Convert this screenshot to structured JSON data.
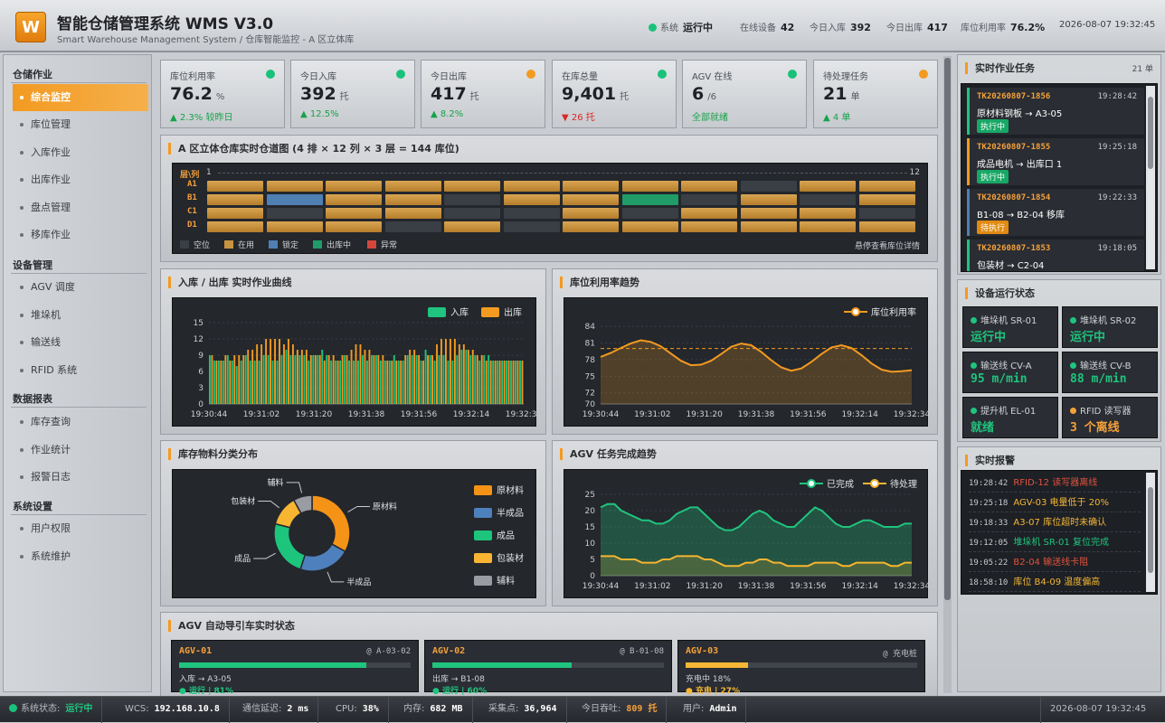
{
  "header": {
    "logo": "W",
    "title": "智能仓储管理系统 WMS V3.0",
    "subtitle": "Smart Warehouse Management System / 仓库智能监控 - A 区立体库",
    "stats": [
      {
        "label": "系统",
        "value": "运行中"
      },
      {
        "label": "在线设备",
        "value": "42"
      },
      {
        "label": "今日入库",
        "value": "392"
      },
      {
        "label": "今日出库",
        "value": "417"
      },
      {
        "label": "库位利用率",
        "value": "76.2%"
      }
    ],
    "datetime": "2026-08-07 19:32:45"
  },
  "sidebar": {
    "groups": [
      {
        "title": "仓储作业",
        "items": [
          "综合监控",
          "库位管理",
          "入库作业",
          "出库作业",
          "盘点管理",
          "移库作业"
        ]
      },
      {
        "title": "设备管理",
        "items": [
          "AGV 调度",
          "堆垛机",
          "输送线",
          "RFID 系统"
        ]
      },
      {
        "title": "数据报表",
        "items": [
          "库存查询",
          "作业统计",
          "报警日志"
        ]
      },
      {
        "title": "系统设置",
        "items": [
          "用户权限",
          "系统维护"
        ]
      }
    ],
    "active": "综合监控"
  },
  "kpis": [
    {
      "label": "库位利用率",
      "value": "76.2",
      "unit": "%",
      "delta": "▲ 2.3% 较昨日",
      "dot": "#19c27a",
      "delta_color": "#16a34a"
    },
    {
      "label": "今日入库",
      "value": "392",
      "unit": "托",
      "delta": "▲ 12.5%",
      "dot": "#19c27a",
      "delta_color": "#16a34a"
    },
    {
      "label": "今日出库",
      "value": "417",
      "unit": "托",
      "delta": "▲ 8.2%",
      "dot": "#f39a21",
      "delta_color": "#16a34a"
    },
    {
      "label": "在库总量",
      "value": "9,401",
      "unit": "托",
      "delta": "▼ 26 托",
      "dot": "#19c27a",
      "delta_color": "#dc2626"
    },
    {
      "label": "AGV 在线",
      "value": "6",
      "unit": "/6",
      "delta": "全部就绪",
      "dot": "#19c27a",
      "delta_color": "#16a34a"
    },
    {
      "label": "待处理任务",
      "value": "21",
      "unit": "单",
      "delta": "▲ 4 单",
      "dot": "#f39a21",
      "delta_color": "#16a34a"
    }
  ],
  "warehouse": {
    "title": "A 区立体仓库实时仓道图 (4 排 × 12 列 × 3 层 = 144 库位)",
    "corner": "层\\列",
    "col_first": "1",
    "col_last": "12",
    "rows": [
      "A1",
      "B1",
      "C1",
      "D1"
    ],
    "cells": [
      [
        "occupied",
        "occupied",
        "occupied",
        "occupied",
        "occupied",
        "occupied",
        "occupied",
        "occupied",
        "occupied",
        "empty",
        "occupied",
        "occupied"
      ],
      [
        "occupied",
        "locked",
        "occupied",
        "occupied",
        "empty",
        "occupied",
        "occupied",
        "outbound",
        "empty",
        "occupied",
        "empty",
        "occupied"
      ],
      [
        "occupied",
        "empty",
        "occupied",
        "occupied",
        "empty",
        "empty",
        "occupied",
        "empty",
        "occupied",
        "occupied",
        "occupied",
        "empty"
      ],
      [
        "occupied",
        "occupied",
        "occupied",
        "empty",
        "occupied",
        "empty",
        "occupied",
        "occupied",
        "occupied",
        "occupied",
        "occupied",
        "occupied"
      ]
    ],
    "legend": [
      {
        "key": "empty",
        "label": "空位",
        "color": "#3a3e45"
      },
      {
        "key": "occupied",
        "label": "在用",
        "color": "#c9943f"
      },
      {
        "key": "locked",
        "label": "锁定",
        "color": "#4f7fb3"
      },
      {
        "key": "outbound",
        "label": "出库中",
        "color": "#1f9c67"
      },
      {
        "key": "error",
        "label": "异常",
        "color": "#d2463c"
      }
    ],
    "hint": "悬停查看库位详情"
  },
  "chart_data": [
    {
      "type": "bar",
      "title": "入库 / 出库 实时作业曲线",
      "x_ticks": [
        "19:30:44",
        "19:31:02",
        "19:31:20",
        "19:31:38",
        "19:31:56",
        "19:32:14",
        "19:32:34"
      ],
      "ylim": [
        0,
        15
      ],
      "y_ticks": [
        0,
        3,
        6,
        9,
        12,
        15
      ],
      "series": [
        {
          "name": "入库",
          "color": "#1fc47e",
          "values": [
            9,
            8,
            8,
            8,
            9,
            8,
            7,
            8,
            9,
            8,
            8,
            8,
            9,
            9,
            8,
            8,
            9,
            10,
            9,
            9,
            9,
            9,
            8,
            9,
            9,
            10,
            9,
            8,
            8,
            8,
            9,
            8,
            8,
            8,
            9,
            8,
            9,
            9,
            8,
            8,
            8,
            9,
            8,
            8,
            9,
            9,
            9,
            8,
            10,
            9,
            8,
            9,
            9,
            8,
            8,
            9,
            10,
            10,
            9,
            9,
            8,
            9,
            9,
            8,
            8,
            8,
            8,
            8,
            8,
            8
          ]
        },
        {
          "name": "出库",
          "color": "#f39a21",
          "values": [
            9,
            8,
            8,
            9,
            8,
            9,
            9,
            9,
            10,
            10,
            11,
            11,
            12,
            12,
            12,
            12,
            11,
            12,
            11,
            10,
            10,
            10,
            9,
            9,
            9,
            8,
            9,
            9,
            8,
            9,
            9,
            10,
            11,
            11,
            10,
            10,
            9,
            9,
            9,
            8,
            8,
            8,
            8,
            9,
            10,
            10,
            9,
            8,
            9,
            9,
            11,
            12,
            12,
            12,
            12,
            11,
            11,
            10,
            10,
            9,
            9,
            8,
            8,
            8,
            8,
            8,
            8,
            8,
            8,
            8
          ]
        }
      ]
    },
    {
      "type": "area",
      "title": "库位利用率趋势",
      "x_ticks": [
        "19:30:44",
        "19:31:02",
        "19:31:20",
        "19:31:38",
        "19:31:56",
        "19:32:14",
        "19:32:34"
      ],
      "ylim": [
        70,
        85
      ],
      "y_ticks": [
        70,
        72,
        75,
        78,
        81,
        84
      ],
      "threshold": 80,
      "series": [
        {
          "name": "库位利用率",
          "color": "#f39a21",
          "values": [
            78.5,
            79.2,
            80.1,
            80.9,
            81.5,
            81.2,
            80.4,
            79.1,
            77.8,
            77.0,
            77.1,
            77.8,
            79.0,
            80.3,
            80.9,
            80.6,
            79.4,
            77.9,
            76.6,
            76.0,
            76.4,
            77.6,
            79.0,
            80.2,
            80.6,
            80.1,
            78.8,
            77.3,
            76.2,
            75.8,
            75.9,
            76.1
          ]
        }
      ]
    },
    {
      "type": "pie",
      "title": "库存物料分类分布",
      "slices": [
        {
          "name": "原材料",
          "value": 33,
          "color": "#f59316"
        },
        {
          "name": "半成品",
          "value": 22,
          "color": "#4d80bd"
        },
        {
          "name": "成品",
          "value": 24,
          "color": "#1dc47c"
        },
        {
          "name": "包装材",
          "value": 13,
          "color": "#f7b531"
        },
        {
          "name": "辅料",
          "value": 8,
          "color": "#999da3"
        }
      ]
    },
    {
      "type": "area",
      "title": "AGV 任务完成趋势",
      "x_ticks": [
        "19:30:44",
        "19:31:02",
        "19:31:20",
        "19:31:38",
        "19:31:56",
        "19:32:14",
        "19:32:34"
      ],
      "ylim": [
        0,
        25
      ],
      "y_ticks": [
        0,
        5,
        10,
        15,
        20,
        25
      ],
      "series": [
        {
          "name": "已完成",
          "color": "#1fc47e",
          "values": [
            21,
            22,
            22,
            20,
            19,
            18,
            17,
            17,
            16,
            16,
            17,
            19,
            20,
            21,
            21,
            19,
            17,
            15,
            14,
            14,
            15,
            17,
            19,
            20,
            19,
            17,
            16,
            15,
            15,
            17,
            19,
            21,
            20,
            18,
            16,
            15,
            15,
            16,
            17,
            17,
            16,
            15,
            15,
            15,
            16,
            16
          ]
        },
        {
          "name": "待处理",
          "color": "#f7b531",
          "values": [
            6,
            6,
            6,
            5,
            5,
            5,
            4,
            4,
            4,
            5,
            5,
            6,
            6,
            6,
            6,
            5,
            5,
            4,
            3,
            3,
            3,
            4,
            4,
            5,
            5,
            4,
            4,
            3,
            3,
            3,
            3,
            4,
            4,
            4,
            4,
            3,
            3,
            4,
            4,
            4,
            4,
            4,
            3,
            3,
            4,
            4
          ]
        }
      ]
    }
  ],
  "agv_panel": {
    "title": "AGV 自动导引车实时状态",
    "cards": [
      {
        "name": "AGV-01",
        "pos": "@ A-03-02",
        "route": "入库 → A3-05",
        "status": "● 运行 | 81%",
        "progress": 0.81,
        "color": "#1fc47e"
      },
      {
        "name": "AGV-02",
        "pos": "@ B-01-08",
        "route": "出库 → B1-08",
        "status": "● 运行 | 60%",
        "progress": 0.6,
        "color": "#1fc47e"
      },
      {
        "name": "AGV-03",
        "pos": "@ 充电桩",
        "route": "充电中 18%",
        "status": "● 充电 | 27%",
        "progress": 0.27,
        "color": "#f5b735"
      }
    ]
  },
  "tasks": {
    "title": "实时作业任务",
    "count": "21 单",
    "items": [
      {
        "id": "TK20260807-1856",
        "time": "19:28:42",
        "desc": "原材料钢板 → A3-05",
        "badge": "执行中",
        "badge_color": "#18a866",
        "border": "#1fc47e"
      },
      {
        "id": "TK20260807-1855",
        "time": "19:25:18",
        "desc": "成品电机 → 出库口 1",
        "badge": "执行中",
        "badge_color": "#18a866",
        "border": "#f39a21"
      },
      {
        "id": "TK20260807-1854",
        "time": "19:22:33",
        "desc": "B1-08 → B2-04 移库",
        "badge": "待执行",
        "badge_color": "#e08a12",
        "border": "#4f7fb3"
      },
      {
        "id": "TK20260807-1853",
        "time": "19:18:05",
        "desc": "包装材 → C2-04",
        "badge": "",
        "badge_color": "#18a866",
        "border": "#1fc47e"
      }
    ]
  },
  "devices": {
    "title": "设备运行状态",
    "items": [
      {
        "name": "堆垛机 SR-01",
        "value": "运行中",
        "color": "#1fc47e"
      },
      {
        "name": "堆垛机 SR-02",
        "value": "运行中",
        "color": "#1fc47e"
      },
      {
        "name": "输送线 CV-A",
        "value": "95 m/min",
        "color": "#1fc47e"
      },
      {
        "name": "输送线 CV-B",
        "value": "88 m/min",
        "color": "#1fc47e"
      },
      {
        "name": "提升机 EL-01",
        "value": "就绪",
        "color": "#1fc47e"
      },
      {
        "name": "RFID 读写器",
        "value": "3 个离线",
        "color": "#f5a13a"
      }
    ]
  },
  "alarms": {
    "title": "实时报警",
    "items": [
      {
        "time": "19:28:42",
        "text": "RFID-12 读写器离线",
        "color": "#e0533f"
      },
      {
        "time": "19:25:18",
        "text": "AGV-03 电量低于 20%",
        "color": "#f5b735"
      },
      {
        "time": "19:18:33",
        "text": "A3-07 库位超时未确认",
        "color": "#f5b735"
      },
      {
        "time": "19:12:05",
        "text": "堆垛机 SR-01 复位完成",
        "color": "#1fc47e"
      },
      {
        "time": "19:05:22",
        "text": "B2-04 输送线卡阻",
        "color": "#e0533f"
      },
      {
        "time": "18:58:10",
        "text": "库位 B4-09 温度偏高",
        "color": "#f5b735"
      }
    ]
  },
  "statusbar": {
    "items": [
      {
        "label": "系统状态:",
        "value": "运行中"
      },
      {
        "label": "WCS:",
        "value": "192.168.10.8"
      },
      {
        "label": "通信延迟:",
        "value": "2 ms"
      },
      {
        "label": "CPU:",
        "value": "38%"
      },
      {
        "label": "内存:",
        "value": "682 MB"
      },
      {
        "label": "采集点:",
        "value": "36,964"
      },
      {
        "label": "今日吞吐:",
        "value": "809 托"
      },
      {
        "label": "用户:",
        "value": "Admin"
      }
    ],
    "datetime": "2026-08-07 19:32:45"
  }
}
